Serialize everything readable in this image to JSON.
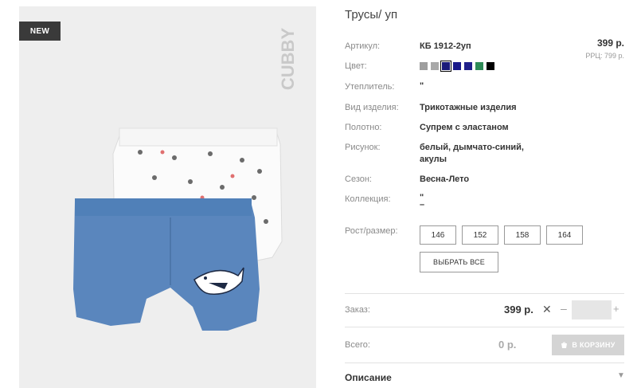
{
  "product": {
    "badge": "NEW",
    "brand": "CUBBY",
    "title": "Трусы/ уп"
  },
  "fields": {
    "article_label": "Артикул:",
    "article_value": "КБ 1912-2уп",
    "color_label": "Цвет:",
    "insulation_label": "Утеплитель:",
    "insulation_value": "\"",
    "type_label": "Вид изделия:",
    "type_value": "Трикотажные изделия",
    "fabric_label": "Полотно:",
    "fabric_value": "Супрем с эластаном",
    "pattern_label": "Рисунок:",
    "pattern_value_1": "белый, дымчато-синий,",
    "pattern_value_2": "акулы",
    "season_label": "Сезон:",
    "season_value": "Весна-Лето",
    "collection_label": "Коллекция:",
    "collection_value_1": "\"",
    "collection_value_2": "–",
    "size_label": "Рост/размер:"
  },
  "price": {
    "main": "399 р.",
    "rrp": "РРЦ: 799 р."
  },
  "swatches": [
    "#9e9e9e",
    "#a9a9a9",
    "#1a1a7a",
    "#1a1a8a",
    "#20208a",
    "#2e8b57",
    "#000000"
  ],
  "sizes": [
    "146",
    "152",
    "158",
    "164"
  ],
  "select_all": "ВЫБРАТЬ ВСЕ",
  "order": {
    "label": "Заказ:",
    "price": "399 р.",
    "times": "✕",
    "minus": "–",
    "plus": "+",
    "qty_value": ""
  },
  "total": {
    "label": "Всего:",
    "value": "0 р.",
    "cart_button": "В КОРЗИНУ"
  },
  "description": {
    "label": "Описание",
    "arrow": "▼"
  }
}
